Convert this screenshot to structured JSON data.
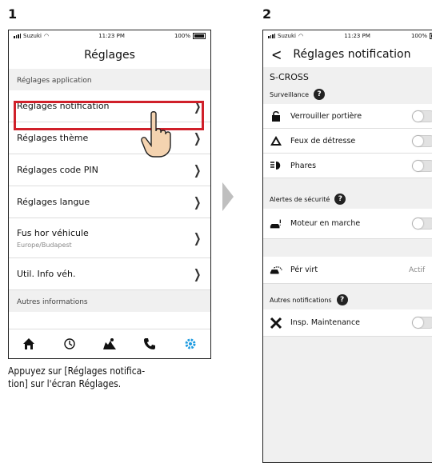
{
  "steps": [
    "1",
    "2"
  ],
  "caption": "Appuyez sur [Réglages notifica-\ntion] sur l'écran Réglages.",
  "status": {
    "carrier": "Suzuki",
    "time": "11:23 PM",
    "battery": "100%"
  },
  "screen1": {
    "title": "Réglages",
    "section_app": "Réglages application",
    "items": [
      {
        "label": "Réglages notification"
      },
      {
        "label": "Réglages thème"
      },
      {
        "label": "Réglages code PIN"
      },
      {
        "label": "Réglages langue"
      },
      {
        "label": "Fus hor véhicule",
        "sub": "Europe/Budapest"
      },
      {
        "label": "Util. Info véh."
      }
    ],
    "section_other": "Autres informations",
    "tabs": [
      "home-icon",
      "history-icon",
      "map-icon",
      "phone-icon",
      "settings-icon"
    ],
    "highlight_color": "#d0202a",
    "active_tab_color": "#1e9be0"
  },
  "screen2": {
    "title": "Réglages notification",
    "vehicle": "S-CROSS",
    "sections": [
      {
        "title": "Surveillance",
        "rows": [
          "Verrouiller portière",
          "Feux de détresse",
          "Phares"
        ]
      },
      {
        "title": "Alertes de sécurité",
        "rows": [
          "Moteur en marche"
        ]
      },
      {
        "title": "",
        "rows": [
          "Pér virt"
        ]
      },
      {
        "title": "Autres notifications",
        "rows": [
          "Insp. Maintenance"
        ]
      }
    ],
    "actif_label": "Actif"
  }
}
